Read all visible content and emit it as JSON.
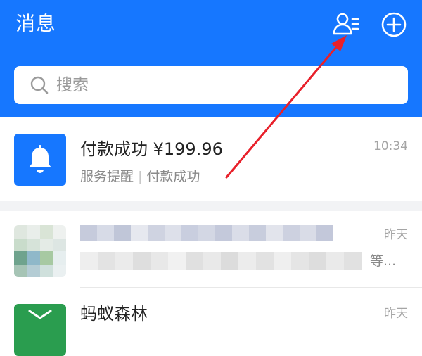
{
  "header": {
    "title": "消息",
    "contacts_icon": "contacts-icon",
    "add_icon": "plus-circle-icon",
    "color": "#1677ff"
  },
  "search": {
    "placeholder": "搜索"
  },
  "messages": [
    {
      "title": "付款成功 ¥199.96",
      "subtitle_part1": "服务提醒",
      "subtitle_part2": "付款成功",
      "time": "10:34",
      "avatar_icon": "bell-icon"
    },
    {
      "time": "昨天",
      "preview_suffix": "等..."
    },
    {
      "title": "蚂蚁森林",
      "time": "昨天"
    }
  ],
  "annotation_color": "#e8202a"
}
